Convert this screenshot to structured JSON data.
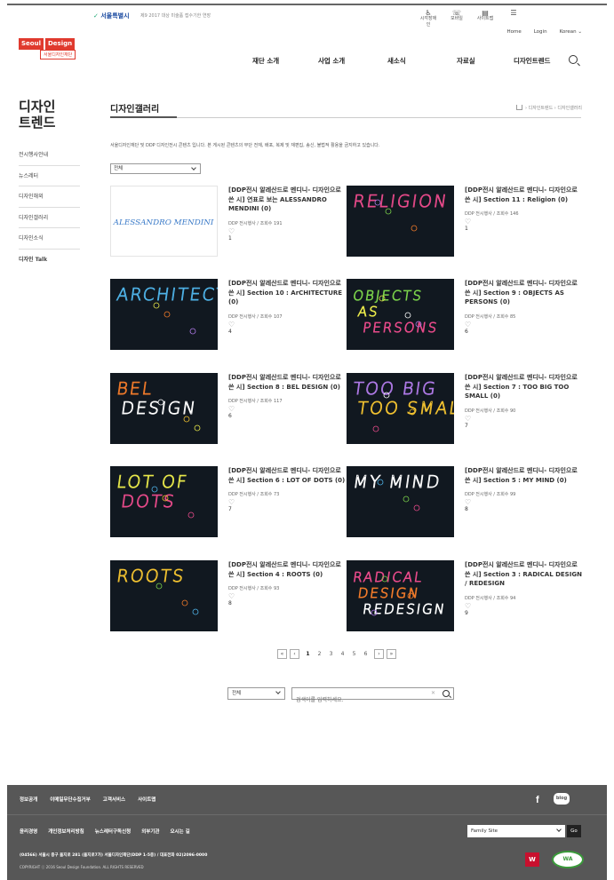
{
  "util": {
    "org_logo": "서울특별시",
    "notice": "제9 2017 대상 미술품 접수기한 연장",
    "icons": [
      {
        "name": "accessibility-icon",
        "glyph": "♿",
        "label": "시각장애인"
      },
      {
        "name": "mobile-icon",
        "glyph": "☏",
        "label": "모바일"
      },
      {
        "name": "sitemap-icon",
        "glyph": "▤",
        "label": "사이트맵"
      },
      {
        "name": "menu-icon",
        "glyph": "☰",
        "label": ""
      }
    ]
  },
  "header": {
    "logo_parts": [
      "Seoul",
      "Design"
    ],
    "logo_sub": "서울디자인재단",
    "lang_links": [
      "Home",
      "Login",
      "Korean"
    ],
    "gnb": [
      "재단 소개",
      "사업 소개",
      "새소식",
      "자료실",
      "디자인트렌드"
    ]
  },
  "sidebar": {
    "title": "디자인 트렌드",
    "items": [
      "전시행사안내",
      "뉴스레터",
      "디자인해외",
      "디자인갤러리",
      "디자인소식",
      "디자인 Talk"
    ]
  },
  "content": {
    "title": "디자인갤러리",
    "breadcrumb": "› 디자인트렌드 › 디자인갤러리",
    "intro": "서울디자인재단 및 DDP 디자인전시 콘텐츠 입니다. 본 게시된 콘텐츠의 무단 전재, 배포, 복제 및 재편집, 송신, 불법적 활용을 금지하고 있습니다.",
    "filter": "전체"
  },
  "gallery": [
    {
      "title": "[DDP전시 알레산드로 멘디니- 디자인으로 쓴 시] 연표로 보는 ALESSANDRO MENDINI (0)",
      "author": "DDP 전시행사",
      "views": "조회수 191",
      "likes": "1",
      "art": "ALESSANDRO MENDINI",
      "style": "signature"
    },
    {
      "title": "[DDP전시 알레산드로 멘디니- 디자인으로 쓴 시] Section 11 : Religion (0)",
      "author": "DDP 전시행사",
      "views": "조회수 146",
      "likes": "1",
      "art": "RELIGION",
      "style": "religion"
    },
    {
      "title": "[DDP전시 알레산드로 멘디니- 디자인으로 쓴 시] Section 10 : ArCHITECTURE (0)",
      "author": "DDP 전시행사",
      "views": "조회수 107",
      "likes": "4",
      "art": "ARCHITECTURE",
      "style": "architecture"
    },
    {
      "title": "[DDP전시 알레산드로 멘디니- 디자인으로 쓴 시] Section 9 : OBJECTS AS PERSONS (0)",
      "author": "DDP 전시행사",
      "views": "조회수 85",
      "likes": "6",
      "art": "OBJECTS AS PERSONS",
      "style": "objects"
    },
    {
      "title": "[DDP전시 알레산드로 멘디니- 디자인으로 쓴 시] Section 8 : BEL DESIGN (0)",
      "author": "DDP 전시행사",
      "views": "조회수 117",
      "likes": "6",
      "art": "BEL DESIGN",
      "style": "bel"
    },
    {
      "title": "[DDP전시 알레산드로 멘디니- 디자인으로 쓴 시] Section 7 : TOO BIG TOO SMALL (0)",
      "author": "DDP 전시행사",
      "views": "조회수 90",
      "likes": "7",
      "art": "TOO BIG TOO SMALL",
      "style": "toobig"
    },
    {
      "title": "[DDP전시 알레산드로 멘디니- 디자인으로 쓴 시] Section 6 : LOT OF DOTS (0)",
      "author": "DDP 전시행사",
      "views": "조회수 73",
      "likes": "7",
      "art": "LOT OF DOTS",
      "style": "dots"
    },
    {
      "title": "[DDP전시 알레산드로 멘디니- 디자인으로 쓴 시] Section 5 : MY MIND (0)",
      "author": "DDP 전시행사",
      "views": "조회수 99",
      "likes": "8",
      "art": "MY MIND",
      "style": "mymind"
    },
    {
      "title": "[DDP전시 알레산드로 멘디니- 디자인으로 쓴 시] Section 4 : ROOTS (0)",
      "author": "DDP 전시행사",
      "views": "조회수 93",
      "likes": "8",
      "art": "ROOTS",
      "style": "roots"
    },
    {
      "title": "[DDP전시 알레산드로 멘디니- 디자인으로 쓴 시] Section 3 : RADICAL DESIGN / REDESIGN",
      "author": "DDP 전시행사",
      "views": "조회수 94",
      "likes": "9",
      "art": "RADICAL DESIGN REDESIGN",
      "style": "radical"
    }
  ],
  "pager": {
    "first": "«",
    "prev": "‹",
    "pages": [
      "1",
      "2",
      "3",
      "4",
      "5",
      "6"
    ],
    "current": "1",
    "next": "›",
    "last": "»"
  },
  "search": {
    "scope": "전체",
    "placeholder": "검색어를 입력하세요."
  },
  "footer": {
    "links1": [
      "정보공개",
      "이메일무단수집거부",
      "고객서비스",
      "사이트맵"
    ],
    "links2": [
      "윤리경영",
      "개인정보처리방침",
      "뉴스레터구독신청",
      "외부기관",
      "오시는 길"
    ],
    "address": "(04566) 서울시 중구 을지로 281 (을지로7가) 서울디자인재단(DDP 1-5층) / 대표전화 02)2096-0000",
    "copyright": "COPYRIGHT ⓒ 2016 Seoul Design Foundation. ALL RIGHTS RESERVED",
    "facebook": "f",
    "blog": "blog",
    "family_site": "Family Site",
    "go": "Go",
    "badge1": "W",
    "badge2": "WA"
  },
  "colors": {
    "brand_red": "#e03a2e",
    "footer_bg": "#575757",
    "thumb_bg": "#111820"
  }
}
